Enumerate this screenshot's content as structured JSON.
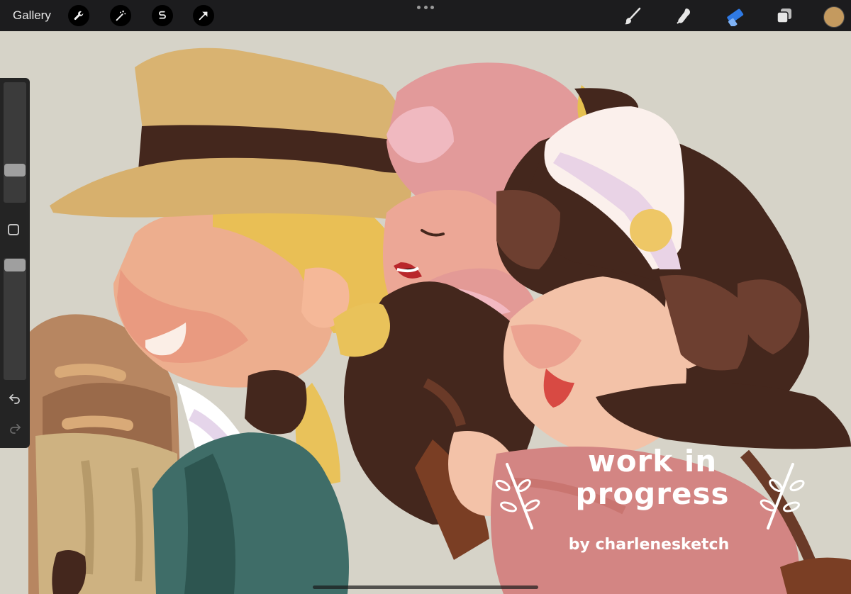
{
  "toolbar": {
    "gallery_label": "Gallery",
    "left_tools": [
      "wrench-icon",
      "magic-wand-icon",
      "selection-icon",
      "transform-arrow-icon"
    ],
    "right_tools": [
      "brush-icon",
      "smudge-icon",
      "eraser-icon",
      "layers-icon"
    ],
    "active_tool": "eraser",
    "active_color": "#c49a5f",
    "accent_color": "#2f7ae5"
  },
  "sidebar": {
    "brush_size": 0.24,
    "opacity": 1.0,
    "undo_icon": "undo-icon",
    "redo_icon": "redo-icon"
  },
  "watermark": {
    "line1": "work in",
    "line2": "progress",
    "byline": "by charlenesketch"
  }
}
